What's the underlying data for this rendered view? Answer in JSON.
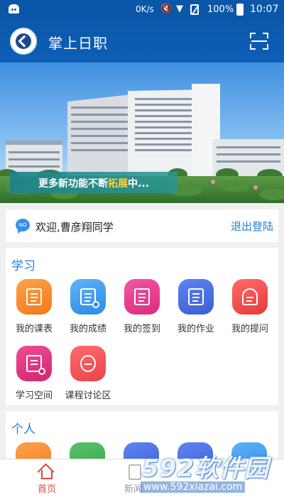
{
  "status_bar": {
    "network_speed": "0K/s",
    "battery_percent": "100%",
    "time": "10:07"
  },
  "header": {
    "title": "掌上日职",
    "logo_icon": "school-emblem-icon",
    "scan_icon": "scan-icon"
  },
  "banner": {
    "caption_prefix": "更多新功能不断",
    "caption_highlight": "拓展",
    "caption_suffix": "中...",
    "highlight_color": "#ffd23c"
  },
  "welcome": {
    "greeting": "欢迎,曹彦翔同学",
    "logout_label": "退出登陆",
    "icon_text": "NO"
  },
  "study": {
    "title": "学习",
    "items": [
      {
        "label": "我的课表",
        "icon": "calendar-icon",
        "color": "#f07a1a"
      },
      {
        "label": "我的成绩",
        "icon": "scores-icon",
        "color": "#2d8ae6"
      },
      {
        "label": "我的签到",
        "icon": "checkin-icon",
        "color": "#dc2a7e"
      },
      {
        "label": "我的作业",
        "icon": "homework-icon",
        "color": "#3a5fd6"
      },
      {
        "label": "我的提问",
        "icon": "question-stamp-icon",
        "color": "#e63a3a"
      },
      {
        "label": "学习空间",
        "icon": "study-space-icon",
        "color": "#d4266e"
      },
      {
        "label": "课程讨论区",
        "icon": "discussion-icon",
        "color": "#e8444b"
      }
    ]
  },
  "personal": {
    "title": "个人"
  },
  "bottom_nav": {
    "items": [
      {
        "label": "首页",
        "icon": "home-icon",
        "active": true
      },
      {
        "label": "新闻",
        "icon": "news-icon",
        "active": false
      }
    ],
    "active_color": "#d64a3a"
  },
  "watermark": {
    "brand": "592软件园",
    "url": "www.592xiazai.com"
  }
}
